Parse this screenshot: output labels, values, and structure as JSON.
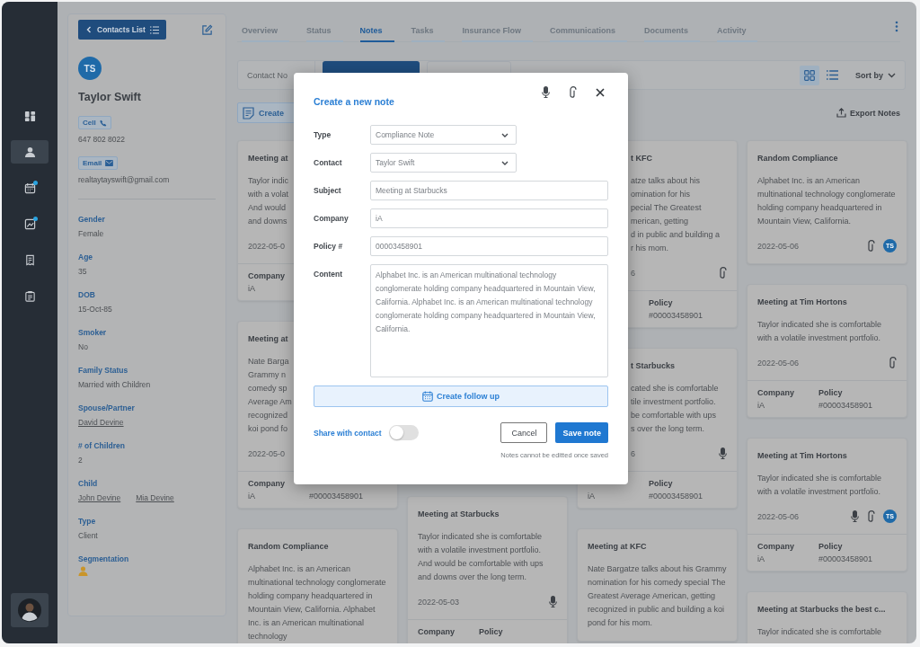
{
  "sidebar": {
    "items": [
      {
        "kind": "dashboard",
        "selected": false,
        "dot": false
      },
      {
        "kind": "contacts",
        "selected": true,
        "dot": false
      },
      {
        "kind": "calendar",
        "selected": false,
        "dot": true
      },
      {
        "kind": "chart",
        "selected": false,
        "dot": true
      },
      {
        "kind": "receipt",
        "selected": false,
        "dot": false
      },
      {
        "kind": "clipboard",
        "selected": false,
        "dot": false
      }
    ]
  },
  "contact": {
    "back_button": "Contacts List",
    "initials": "TS",
    "name": "Taylor Swift",
    "phone_label": "Cell",
    "phone": "647 802 8022",
    "email_label": "Email",
    "email": "realtaytayswift@gmail.com",
    "fields": [
      {
        "label": "Gender",
        "kind": "text",
        "values": [
          "Female"
        ]
      },
      {
        "label": "Age",
        "kind": "text",
        "values": [
          "35"
        ]
      },
      {
        "label": "DOB",
        "kind": "text",
        "values": [
          "15-Oct-85"
        ]
      },
      {
        "label": "Smoker",
        "kind": "text",
        "values": [
          "No"
        ]
      },
      {
        "label": "Family Status",
        "kind": "text",
        "values": [
          "Married with Children"
        ]
      },
      {
        "label": "Spouse/Partner",
        "kind": "link",
        "values": [
          "David Devine"
        ]
      },
      {
        "label": "# of Children",
        "kind": "text",
        "values": [
          "2"
        ]
      },
      {
        "label": "Child",
        "kind": "link",
        "values": [
          "John Devine",
          "Mia Devine"
        ]
      },
      {
        "label": "Type",
        "kind": "text",
        "values": [
          "Client"
        ]
      },
      {
        "label": "Segmentation",
        "kind": "icon"
      }
    ]
  },
  "tabs": [
    {
      "label": "Overview",
      "selected": false
    },
    {
      "label": "Status",
      "selected": false
    },
    {
      "label": "Notes",
      "selected": true
    },
    {
      "label": "Tasks",
      "selected": false
    },
    {
      "label": "Insurance Flow",
      "selected": false
    },
    {
      "label": "Communications",
      "selected": false
    },
    {
      "label": "Documents",
      "selected": false
    },
    {
      "label": "Activity",
      "selected": false
    }
  ],
  "toolbar": {
    "segment": "Contact No",
    "views": [
      {
        "kind": "grid",
        "selected": true
      },
      {
        "kind": "list",
        "selected": false
      }
    ],
    "sort": "Sort by",
    "create_button": "Create",
    "export_button": "Export Notes"
  },
  "columns": [
    [
      {
        "title": "Meeting at",
        "lines": [
          "Taylor indic",
          "with a volat",
          "And would",
          "and downs"
        ],
        "date": "2022-05-0",
        "footer": {
          "company_label": "Company",
          "company": "iA"
        }
      },
      {
        "title": "Meeting at",
        "lines": [
          "Nate Barga",
          "Grammy n",
          "comedy sp",
          "Average Am",
          "recognized",
          "koi pond fo"
        ],
        "date": "2022-05-0",
        "footer": {
          "company_label": "Company",
          "company": "iA",
          "policy": "#00003458901"
        }
      },
      {
        "title": "Random Compliance",
        "body": "Alphabet Inc. is an American multinational technology conglomerate holding company headquartered in Mountain View, California. Alphabet Inc. is an American multinational technology"
      }
    ],
    [
      {
        "title": "Meeting at Starbucks",
        "body": "Taylor indicated she is comfortable with a volatile investment portfolio. And would be comfortable with ups and downs over the long term.",
        "date": "2022-05-03",
        "icons": [
          {
            "kind": "mic"
          }
        ],
        "footer": {
          "company_label": "Company",
          "policy_label": "Policy"
        }
      }
    ],
    [
      {
        "title": "t KFC",
        "lines": [
          "atze talks about his",
          "omination for his",
          "pecial The Greatest",
          "merican, getting",
          "d in public and building a",
          "r his mom."
        ],
        "date": "6",
        "icons": [
          {
            "kind": "clip"
          }
        ],
        "footer": {
          "policy_label": "Policy",
          "policy": "#00003458901"
        }
      },
      {
        "title": "t Starbucks",
        "lines": [
          "cated she is comfortable",
          "tile investment portfolio.",
          "be comfortable with ups",
          "s over the long term."
        ],
        "date": "6",
        "icons": [
          {
            "kind": "mic"
          }
        ],
        "footer": {
          "company": "iA",
          "policy_label": "Policy",
          "policy": "#00003458901"
        }
      },
      {
        "title": "Meeting at KFC",
        "body": "Nate Bargatze talks about his Grammy nomination for his comedy special The Greatest Average American, getting recognized in public and building a koi pond for his mom."
      }
    ],
    [
      {
        "title": "Random Compliance",
        "body": "Alphabet Inc. is an American multinational technology conglomerate holding company headquartered in Mountain View, California.",
        "date": "2022-05-06",
        "icons": [
          {
            "kind": "clip"
          },
          {
            "kind": "avatar",
            "text": "TS"
          }
        ]
      },
      {
        "title": "Meeting at Tim Hortons",
        "body": "Taylor indicated she is comfortable with a volatile investment portfolio.",
        "date": "2022-05-06",
        "icons": [
          {
            "kind": "clip"
          }
        ],
        "footer": {
          "company_label": "Company",
          "company": "iA",
          "policy_label": "Policy",
          "policy": "#00003458901"
        }
      },
      {
        "title": "Meeting at Tim Hortons",
        "body": "Taylor indicated she is comfortable with a volatile investment portfolio.",
        "date": "2022-05-06",
        "icons": [
          {
            "kind": "mic"
          },
          {
            "kind": "clip"
          },
          {
            "kind": "avatar",
            "text": "TS"
          }
        ],
        "footer": {
          "company_label": "Company",
          "company": "iA",
          "policy_label": "Policy",
          "policy": "#00003458901"
        }
      },
      {
        "title": "Meeting at Starbucks the best c...",
        "body": "Taylor indicated she is comfortable"
      }
    ]
  ],
  "modal": {
    "title": "Create a new note",
    "fields": [
      {
        "label": "Type",
        "kind": "select",
        "value": "Compliance Note"
      },
      {
        "label": "Contact",
        "kind": "select",
        "value": "Taylor Swift"
      },
      {
        "label": "Subject",
        "kind": "text",
        "value": "Meeting at Starbucks"
      },
      {
        "label": "Company",
        "kind": "text",
        "value": "iA"
      },
      {
        "label": "Policy #",
        "kind": "text",
        "value": "00003458901"
      },
      {
        "label": "Content",
        "kind": "textarea",
        "value": "Alphabet Inc. is an American multinational technology conglomerate holding company headquartered in Mountain View, California. Alphabet Inc. is an American multinational technology conglomerate holding company headquartered in Mountain View, California."
      }
    ],
    "follow_up_button": "Create follow up",
    "share": {
      "label": "Share with contact",
      "on": false
    },
    "cancel_button": "Cancel",
    "save_button": "Save note",
    "note": "Notes cannot be editted once saved"
  }
}
